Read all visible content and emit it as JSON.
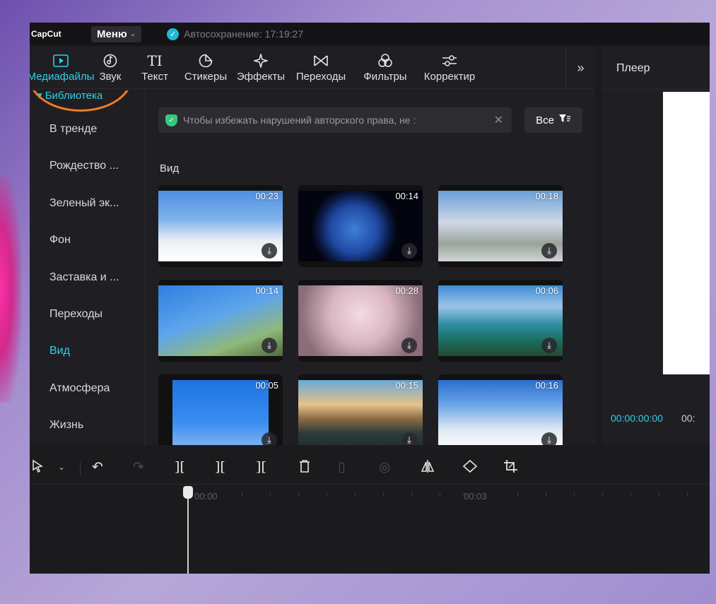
{
  "titlebar": {
    "logo": "CapCut",
    "menu_label": "Меню",
    "autosave": "Автосохранение: 17:19:27"
  },
  "toolbar": {
    "items": [
      {
        "label": "Медиафайлы",
        "icon": "media-icon"
      },
      {
        "label": "Звук",
        "icon": "music-icon"
      },
      {
        "label": "Текст",
        "icon": "text-icon"
      },
      {
        "label": "Стикеры",
        "icon": "sticker-icon"
      },
      {
        "label": "Эффекты",
        "icon": "sparkle-icon"
      },
      {
        "label": "Переходы",
        "icon": "transition-icon"
      },
      {
        "label": "Фильтры",
        "icon": "filter-icon"
      },
      {
        "label": "Корректир",
        "icon": "adjust-icon"
      }
    ],
    "more": "»"
  },
  "sidebar": {
    "library_tab": "▾ Библиотека",
    "categories": [
      "В тренде",
      "Рождество ...",
      "Зеленый эк...",
      "Фон",
      "Заставка и ...",
      "Переходы",
      "Вид",
      "Атмосфера",
      "Жизнь"
    ],
    "active": "Вид"
  },
  "content": {
    "notice": "Чтобы избежать нарушений авторского права, не :",
    "filter_label": "Все",
    "section_title": "Вид",
    "thumbnails": [
      {
        "duration": "00:23"
      },
      {
        "duration": "00:14"
      },
      {
        "duration": "00:18"
      },
      {
        "duration": "00:14"
      },
      {
        "duration": "00:28"
      },
      {
        "duration": "00:06"
      },
      {
        "duration": "00:05"
      },
      {
        "duration": "00:15"
      },
      {
        "duration": "00:16"
      }
    ]
  },
  "player": {
    "title": "Плеер",
    "current_time": "00:00:00:00",
    "total_time_partial": "00:"
  },
  "timeline": {
    "ruler": [
      "00:00",
      "00:03"
    ]
  },
  "colors": {
    "accent": "#2fd0e8",
    "highlight_ring": "#f07a2a"
  }
}
